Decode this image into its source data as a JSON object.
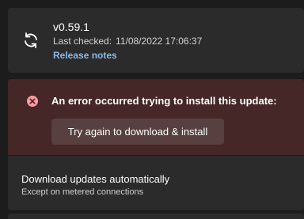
{
  "update": {
    "version": "v0.59.1",
    "last_checked_label": "Last checked:",
    "last_checked_value": "11/08/2022 17:06:37",
    "release_notes_label": "Release notes",
    "icon": "sync-icon"
  },
  "error": {
    "message": "An error occurred trying to install this update:",
    "icon": "error-circle-icon",
    "retry_label": "Try again to download & install",
    "color": "#ff99a4"
  },
  "auto_update": {
    "title": "Download updates automatically",
    "subtitle": "Except on metered connections"
  },
  "colors": {
    "accent": "#8ab9e8",
    "error_background": "#442726",
    "card_background": "#2b2b2b"
  }
}
